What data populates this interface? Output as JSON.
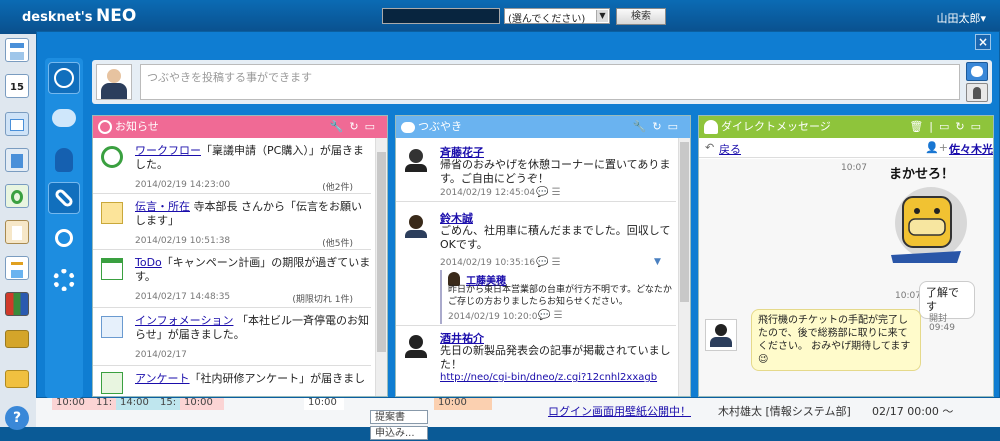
{
  "app": {
    "logo_line1": "desknet's",
    "logo_line2": "NEO",
    "user": "山田太郎▾"
  },
  "search": {
    "select": "(選んでください)",
    "button": "検索"
  },
  "post": {
    "placeholder": "つぶやきを投稿する事ができます"
  },
  "close_label": "×",
  "icons": {
    "leftnav": [
      "portal-icon",
      "calendar-icon",
      "mail-icon",
      "facility-icon",
      "workflow-icon",
      "clipboard-icon",
      "memo-icon",
      "books-icon",
      "folder-icon",
      "folder-open-icon",
      "help-icon"
    ],
    "sidetools": [
      "antenna-icon",
      "chat-bubble-icon",
      "person-icon",
      "link-icon",
      "magnifier-icon",
      "gear-icon"
    ]
  },
  "calendar_day": "15",
  "notices": {
    "title": "お知らせ",
    "items": [
      {
        "link": "ワークフロー",
        "text": "「稟議申請（PC購入）」が届きました。",
        "time": "2014/02/19 14:23:00",
        "count": "(他2件)"
      },
      {
        "link": "伝言・所在",
        "text": "寺本部長 さんから「伝言をお願いします」",
        "time": "2014/02/19 10:51:38",
        "count": "(他5件)"
      },
      {
        "link": "ToDo",
        "text": "「キャンペーン計画」の期限が過ぎています。",
        "time": "2014/02/17 14:48:35",
        "count": "(期限切れ 1件)"
      },
      {
        "link": "インフォメーション",
        "text": "「本社ビル一斉停電のお知らせ」が届きました。",
        "time": "2014/02/17",
        "count": ""
      },
      {
        "link": "アンケート",
        "text": "「社内研修アンケート」が届きまし",
        "time": "",
        "count": ""
      }
    ]
  },
  "tweets": {
    "title": "つぶやき",
    "items": [
      {
        "name": "斉藤花子",
        "body": "帰省のおみやげを休憩コーナーに置いてあります。ご自由にどうぞ！",
        "time": "2014/02/19 12:45:04"
      },
      {
        "name": "鈴木誠",
        "body": "ごめん、社用車に積んだままでした。回収してOKです。",
        "time": "2014/02/19 10:35:16"
      },
      {
        "name": "工藤美穂",
        "body": "昨日から東日本営業部の台車が行方不明です。どなたかご存じの方おりましたらお知らせください。",
        "time": "2014/02/19 10:20:05"
      },
      {
        "name": "酒井祐介",
        "body": "先日の新製品発表会の記事が掲載されていました！",
        "link": "http://neo/cgi-bin/dneo/z.cgi?12cnhl2xxagb"
      }
    ]
  },
  "dm": {
    "title": "ダイレクトメッセージ",
    "back": "戻る",
    "partner": "佐々木光",
    "stamp_text": "まかせろ！",
    "messages": [
      {
        "time": "10:07"
      },
      {
        "time": "10:07",
        "text": "了解です"
      },
      {
        "time": "09:49",
        "status": "開封",
        "text": "飛行機のチケットの手配が完了したので、後で総務部に取りに来てください。 おみやげ期待してます😉"
      }
    ]
  },
  "background": {
    "cells": [
      "10:00",
      "11:",
      "14:00",
      "15:",
      "10:00",
      "10:00",
      "提案書",
      "申込み...",
      "10:00"
    ],
    "notice_link": "ログイン画面用壁紙公開中！",
    "notice_author": "木村雄太 [情報システム部]",
    "notice_date": "02/17 00:00 ～"
  },
  "colors": {
    "notice_head": "#f06a95",
    "tweet_head": "#6ab3f0",
    "dm_head": "#8ec43b"
  }
}
